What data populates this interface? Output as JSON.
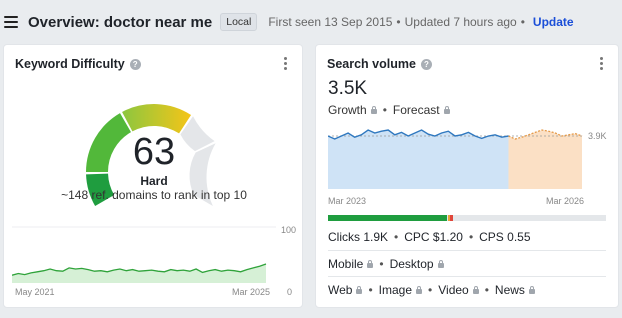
{
  "header": {
    "title": "Overview: doctor near me",
    "badge": "Local",
    "first_seen": "First seen 13 Sep 2015",
    "updated": "Updated 7 hours ago",
    "update_link": "Update"
  },
  "kd_card": {
    "title": "Keyword Difficulty",
    "value": "63",
    "value_fraction": 0.63,
    "label": "Hard",
    "description": "~148 ref. domains to rank in top 10",
    "chart": {
      "x_start": "May 2021",
      "x_end": "Mar 2025",
      "y_max": "100",
      "y_min": "0"
    }
  },
  "sv_card": {
    "title": "Search volume",
    "value": "3.5K",
    "growth_label": "Growth",
    "forecast_label": "Forecast",
    "chart": {
      "x_start": "Mar 2023",
      "x_end": "Mar 2026",
      "y_ref": "3.9K"
    },
    "metrics": {
      "clicks": "Clicks 1.9K",
      "cpc": "CPC $1.20",
      "cps": "CPS 0.55"
    },
    "devices": [
      "Mobile",
      "Desktop"
    ],
    "serp_types": [
      "Web",
      "Image",
      "Video",
      "News"
    ]
  },
  "colors": {
    "kd_green_dark": "#1f9d3f",
    "kd_green": "#52b83a",
    "kd_yellow": "#f1c40f",
    "sv_line": "#2f78bf",
    "forecast": "#f0a04b",
    "update_link": "#1a4ed8"
  }
}
